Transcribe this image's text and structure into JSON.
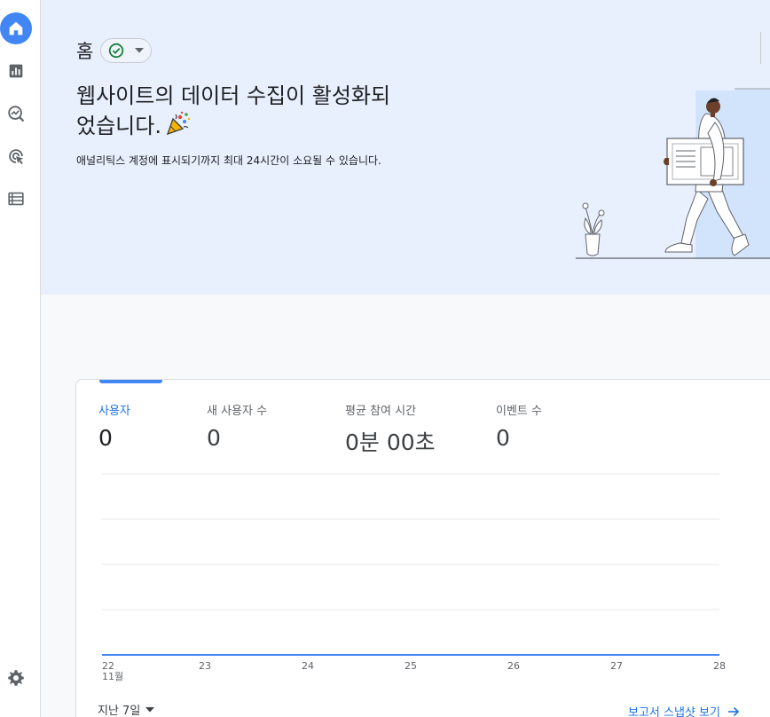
{
  "rail": {
    "items": [
      {
        "name": "home",
        "active": true
      },
      {
        "name": "reports"
      },
      {
        "name": "explore"
      },
      {
        "name": "advertising"
      },
      {
        "name": "configure"
      }
    ],
    "settings": "admin"
  },
  "header": {
    "title": "홈",
    "status_icon": "check-circle-icon"
  },
  "hero": {
    "heading_line1": "웹사이트의 데이터 수집이 활성화되",
    "heading_line2": "었습니다.",
    "subtitle": "애널리틱스 계정에 표시되기까지 최대 24시간이 소요될 수 있습니다."
  },
  "metrics": [
    {
      "label": "사용자",
      "value": "0",
      "active": true
    },
    {
      "label": "새 사용자 수",
      "value": "0"
    },
    {
      "label": "평균 참여 시간",
      "value": "0분 00초"
    },
    {
      "label": "이벤트 수",
      "value": "0"
    }
  ],
  "chart_data": {
    "type": "line",
    "categories": [
      "22",
      "23",
      "24",
      "25",
      "26",
      "27",
      "28"
    ],
    "month_label": "11월",
    "series": [
      {
        "values": [
          0,
          0,
          0,
          0,
          0,
          0,
          0
        ],
        "color": "#4285f4"
      }
    ],
    "grid": true
  },
  "footer": {
    "range_label": "지난 7일",
    "report_link": "보고서 스냅샷 보기"
  },
  "colors": {
    "accent": "#1a73e8",
    "hero_bg": "#e8f0fe",
    "line": "#4285f4"
  }
}
